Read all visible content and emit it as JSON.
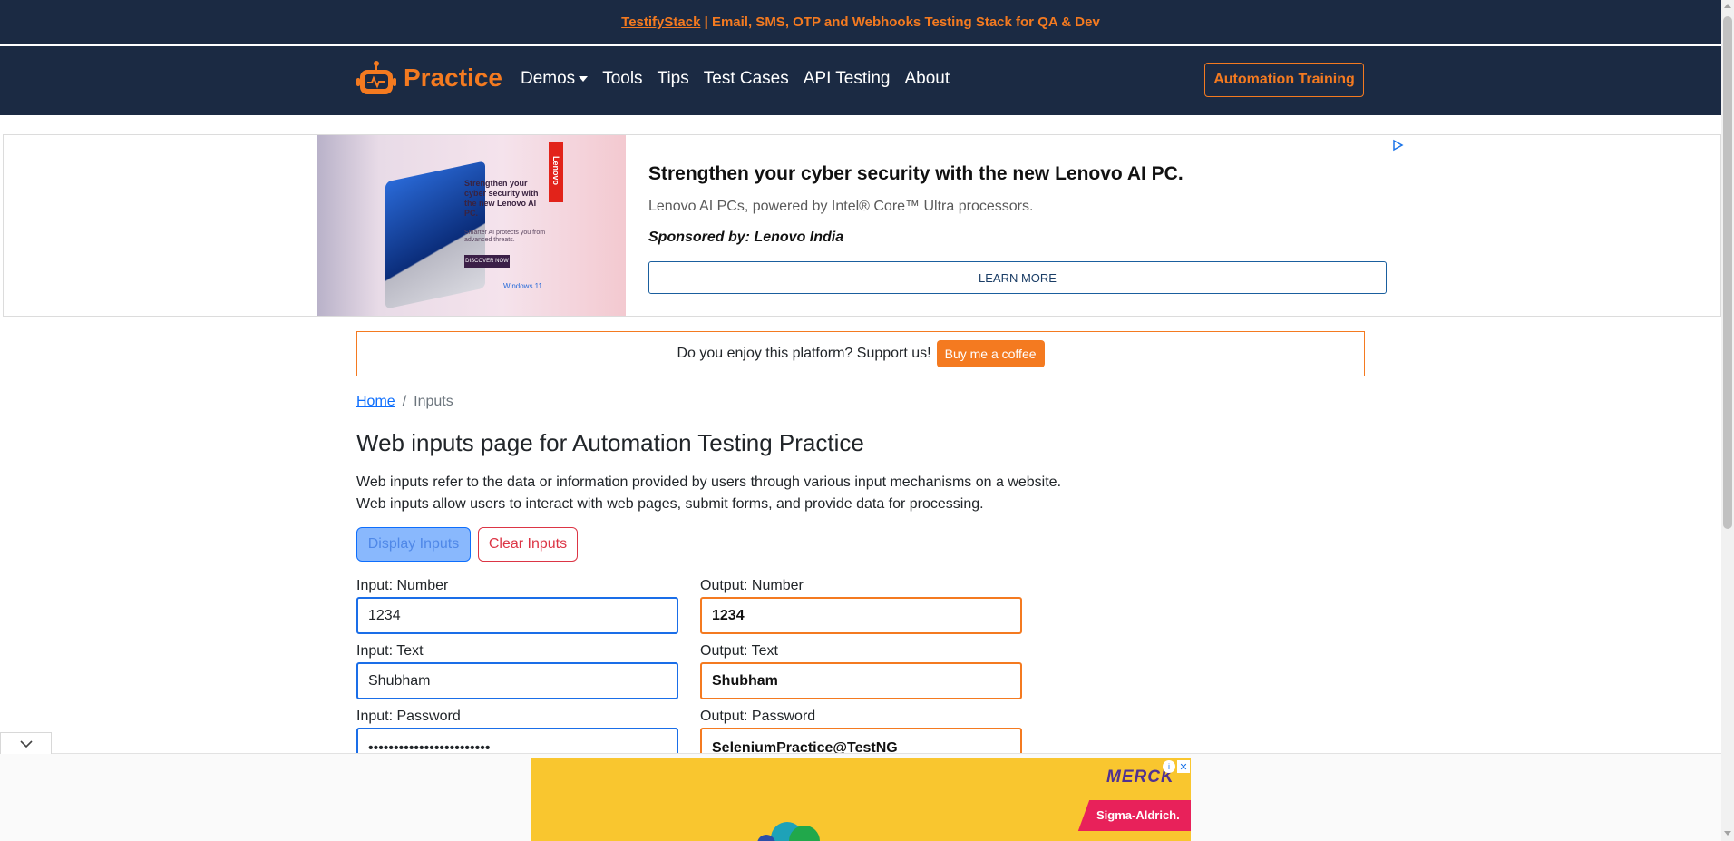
{
  "topbar": {
    "link_text": "TestifyStack",
    "rest_text": " | Email, SMS, OTP and Webhooks Testing Stack for QA & Dev"
  },
  "navbar": {
    "brand": "Practice",
    "links": [
      "Demos",
      "Tools",
      "Tips",
      "Test Cases",
      "API Testing",
      "About"
    ],
    "cta": "Automation Training"
  },
  "ad": {
    "image_copy": "Strengthen your cyber security with the new Lenovo AI PC.",
    "image_small": "Smarter AI protects you from advanced threats.",
    "image_cta": "DISCOVER NOW",
    "image_brand": "Lenovo",
    "image_os": "Windows 11",
    "headline": "Strengthen your cyber security with the new Lenovo AI PC.",
    "description": "Lenovo AI PCs, powered by Intel® Core™ Ultra processors.",
    "sponsor": "Sponsored by: Lenovo India",
    "button": "LEARN MORE"
  },
  "support": {
    "text": "Do you enjoy this platform? Support us!",
    "button": "Buy me a coffee"
  },
  "breadcrumb": {
    "home": "Home",
    "separator": "/",
    "current": "Inputs"
  },
  "main": {
    "title": "Web inputs page for Automation Testing Practice",
    "desc_line1": "Web inputs refer to the data or information provided by users through various input mechanisms on a website.",
    "desc_line2": "Web inputs allow users to interact with web pages, submit forms, and provide data for processing.",
    "display_button": "Display Inputs",
    "clear_button": "Clear Inputs"
  },
  "fields": {
    "input_number_label": "Input: Number",
    "input_number_value": "1234",
    "output_number_label": "Output: Number",
    "output_number_value": "1234",
    "input_text_label": "Input: Text",
    "input_text_value": "Shubham",
    "output_text_label": "Output: Text",
    "output_text_value": "Shubham",
    "input_password_label": "Input: Password",
    "input_password_value": "••••••••••••••••••••••••",
    "output_password_label": "Output: Password",
    "output_password_value": "SeleniumPractice@TestNG"
  },
  "bottom_ad": {
    "brand": "MERCK",
    "sub_brand": "Sigma-Aldrich."
  },
  "colors": {
    "navy": "#1b2a43",
    "orange": "#f47a20",
    "input_border": "#1a6ee8",
    "danger": "#dc3545"
  }
}
